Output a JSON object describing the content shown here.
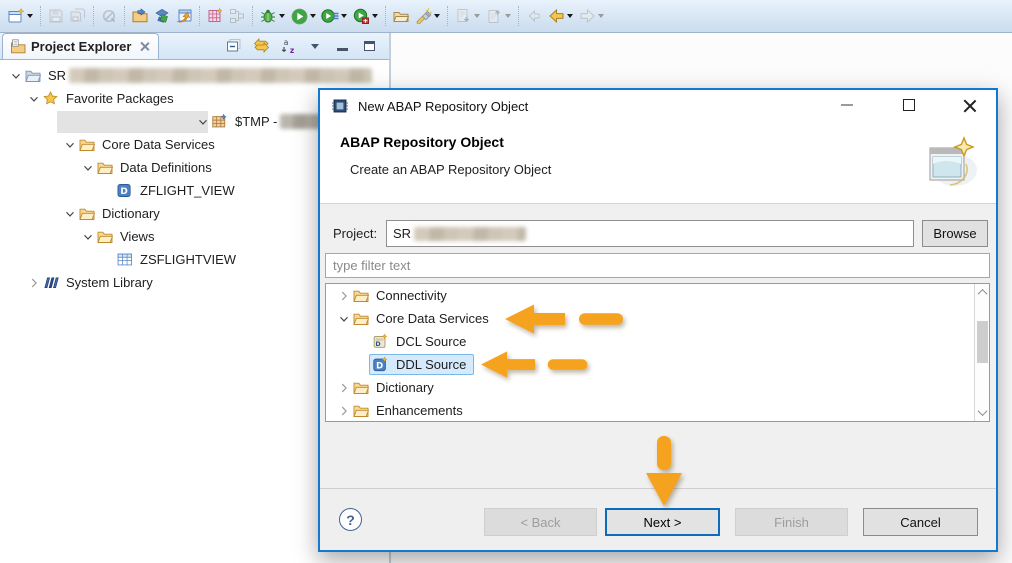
{
  "toolbar": {
    "icons": [
      {
        "name": "new-wizard",
        "dropdown": true
      },
      {
        "name": "save",
        "disabled": true
      },
      {
        "name": "save-all",
        "disabled": true
      },
      {
        "name": "pin-editor",
        "disabled": true
      },
      {
        "name": "open-abap-object"
      },
      {
        "name": "run-abap-object"
      },
      {
        "name": "open-sap-gui"
      },
      {
        "name": "new-ddic-object"
      },
      {
        "name": "relation-explorer",
        "disabled": true
      },
      {
        "name": "debug",
        "dropdown": true
      },
      {
        "name": "run",
        "dropdown": true
      },
      {
        "name": "profile",
        "dropdown": true
      },
      {
        "name": "coverage",
        "dropdown": true
      },
      {
        "name": "open-resource"
      },
      {
        "name": "search",
        "dropdown": true
      },
      {
        "name": "next-annotation",
        "disabled": true,
        "dropdown": true
      },
      {
        "name": "previous-annotation",
        "disabled": true,
        "dropdown": true
      },
      {
        "name": "last-edit-location",
        "disabled": true
      },
      {
        "name": "back",
        "dropdown": true
      },
      {
        "name": "forward",
        "disabled": true,
        "dropdown": true
      }
    ]
  },
  "explorer": {
    "tab_label": "Project Explorer",
    "view_toolbar": [
      "collapse-all",
      "link-with-editor",
      "sort-alphabetical",
      "view-menu",
      "minimize",
      "maximize"
    ],
    "tree": [
      {
        "label": "SR",
        "redacted": true,
        "icon": "abap-project",
        "state": "expanded"
      },
      {
        "label": "Favorite Packages",
        "icon": "favorites-star",
        "state": "expanded"
      },
      {
        "label": "$TMP -",
        "redacted": true,
        "icon": "package",
        "state": "expanded",
        "selected": true
      },
      {
        "label": "Core Data Services",
        "icon": "folder",
        "state": "expanded"
      },
      {
        "label": "Data Definitions",
        "icon": "folder",
        "state": "expanded"
      },
      {
        "label": "ZFLIGHT_VIEW",
        "icon": "ddl-source"
      },
      {
        "label": "Dictionary",
        "icon": "folder",
        "state": "expanded"
      },
      {
        "label": "Views",
        "icon": "folder",
        "state": "expanded"
      },
      {
        "label": "ZSFLIGHTVIEW",
        "icon": "database-view"
      },
      {
        "label": "System Library",
        "icon": "library",
        "state": "collapsed"
      }
    ]
  },
  "dialog": {
    "titlebar": {
      "title": "New ABAP Repository Object"
    },
    "header": {
      "title": "ABAP Repository Object",
      "subtitle": "Create an ABAP Repository Object"
    },
    "project": {
      "label": "Project:",
      "value": "SR",
      "value_redacted": true,
      "browse_label": "Browse"
    },
    "filter_placeholder": "type filter text",
    "tree": [
      {
        "label": "Connectivity",
        "icon": "folder",
        "state": "collapsed"
      },
      {
        "label": "Core Data Services",
        "icon": "folder",
        "state": "expanded",
        "annotated": true
      },
      {
        "label": "DCL Source",
        "icon": "dcl-source"
      },
      {
        "label": "DDL Source",
        "icon": "ddl-source-new",
        "selected": true,
        "annotated": true
      },
      {
        "label": "Dictionary",
        "icon": "folder",
        "state": "collapsed"
      },
      {
        "label": "Enhancements",
        "icon": "folder",
        "state": "collapsed"
      }
    ],
    "buttons": [
      {
        "label": "< Back",
        "enabled": false
      },
      {
        "label": "Next >",
        "enabled": true,
        "default": true,
        "annotated": true
      },
      {
        "label": "Finish",
        "enabled": false
      },
      {
        "label": "Cancel",
        "enabled": true
      }
    ],
    "help_glyph": "?"
  },
  "annotations": {
    "arrow_color": "#F5A31F",
    "targets": [
      "core-data-services-node",
      "ddl-source-node",
      "next-button"
    ]
  },
  "colors": {
    "dialog_border": "#1278d2",
    "toolbar_bg": "#cadcee",
    "selection_bg": "#d5eafc",
    "selection_border": "#79b8e8",
    "inactive_selection_bg": "#e3e3e3"
  }
}
